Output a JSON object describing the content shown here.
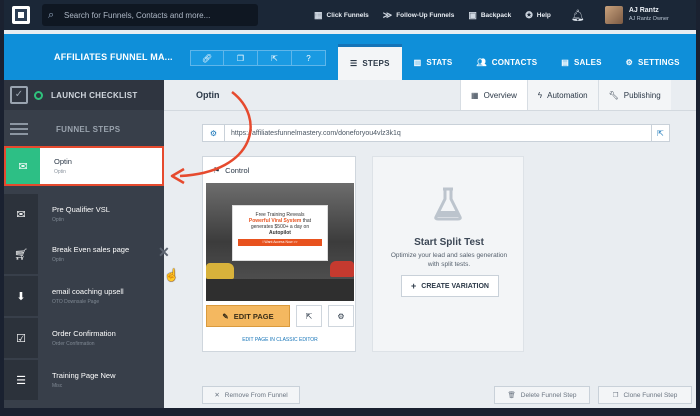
{
  "topbar": {
    "search_placeholder": "Search for Funnels, Contacts and more...",
    "nav": [
      "Click Funnels",
      "Follow-Up Funnels",
      "Backpack",
      "Help"
    ],
    "user_name": "AJ Rantz",
    "user_role": "AJ Rantz   Owner"
  },
  "header": {
    "funnel_title": "AFFILIATES FUNNEL MA...",
    "tabs": [
      "STEPS",
      "STATS",
      "CONTACTS",
      "SALES",
      "SETTINGS"
    ]
  },
  "sidebar": {
    "checklist_label": "LAUNCH CHECKLIST",
    "steps_label": "FUNNEL STEPS",
    "steps": [
      {
        "name": "Optin",
        "sub": "Optin"
      },
      {
        "name": "Pre Qualifier VSL",
        "sub": "Optin"
      },
      {
        "name": "Break Even sales page",
        "sub": "Optin"
      },
      {
        "name": "email coaching upsell",
        "sub": "OTO Downsale Page"
      },
      {
        "name": "Order Confirmation",
        "sub": "Order Confirmation"
      },
      {
        "name": "Training Page New",
        "sub": "Misc"
      }
    ]
  },
  "main": {
    "title": "Optin",
    "subtabs": [
      "Overview",
      "Automation",
      "Publishing"
    ],
    "url": "https://affiliatesfunnelmastery.com/doneforyou4vlz3k1q",
    "card": {
      "label": "Control",
      "promo_line1": "Free Training Reveals",
      "promo_line2": "Powerful Viral System",
      "promo_line2b": " that",
      "promo_line3": "generates $500+ a day on",
      "promo_line4": "Autopilot",
      "promo_button": "I Want Access Now >>",
      "edit_label": "EDIT PAGE",
      "classic_link": "EDIT PAGE IN CLASSIC EDITOR"
    },
    "split": {
      "title": "Start Split Test",
      "desc": "Optimize your lead and sales generation with split tests.",
      "button": "CREATE VARIATION"
    },
    "footer": {
      "remove": "Remove From Funnel",
      "delete": "Delete Funnel Step",
      "clone": "Clone Funnel Step"
    }
  },
  "colors": {
    "header_blue": "#0f8fd9",
    "active_green": "#2dbf85",
    "highlight_red": "#e64a2e",
    "edit_orange": "#f4b860"
  }
}
